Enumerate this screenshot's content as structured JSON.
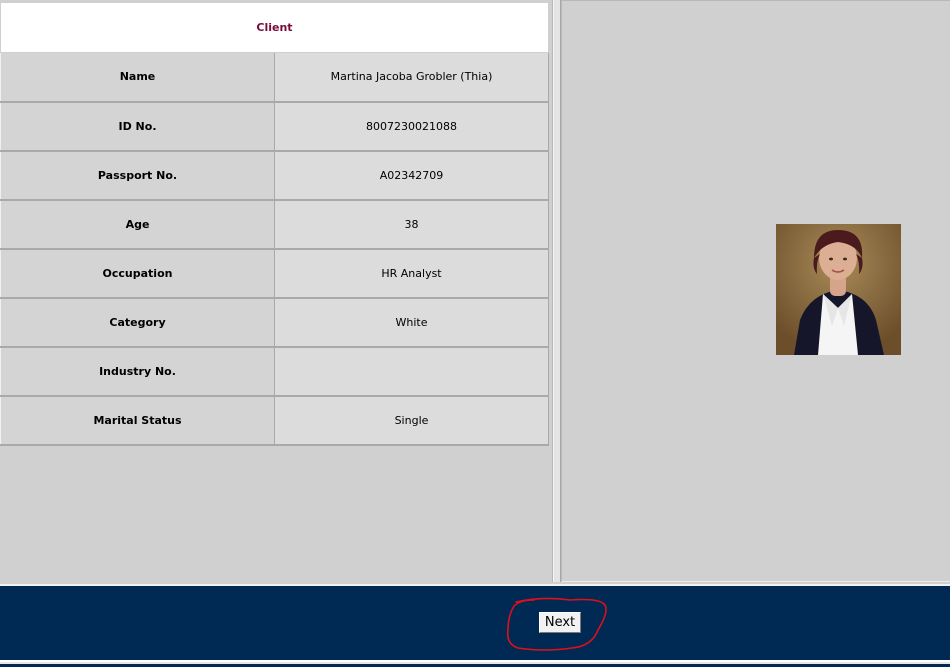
{
  "client_table": {
    "header": "Client",
    "rows": [
      {
        "label": "Name",
        "value": "Martina Jacoba Grobler (Thia)"
      },
      {
        "label": "ID No.",
        "value": "8007230021088"
      },
      {
        "label": "Passport No.",
        "value": "A02342709"
      },
      {
        "label": "Age",
        "value": "38"
      },
      {
        "label": "Occupation",
        "value": "HR Analyst"
      },
      {
        "label": "Category",
        "value": "White"
      },
      {
        "label": "Industry No.",
        "value": ""
      },
      {
        "label": "Marital Status",
        "value": "Single"
      }
    ]
  },
  "footer": {
    "next_label": "Next"
  },
  "colors": {
    "footer_background": "#002a54",
    "header_text": "#7a0a3c",
    "annotation_circle": "#e0101a"
  },
  "icons": {
    "photo": "client-photo-icon"
  }
}
